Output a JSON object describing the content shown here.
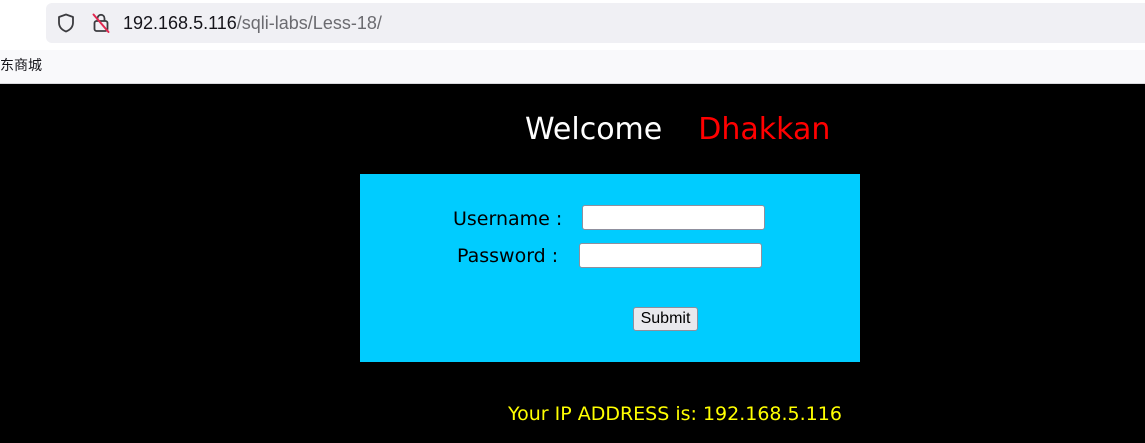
{
  "browser": {
    "url_host": "192.168.5.116",
    "url_path": "/sqli-labs/Less-18/",
    "bookmark": "东商城"
  },
  "page": {
    "welcome": "Welcome",
    "name": "Dhakkan",
    "form": {
      "username_label": "Username :",
      "password_label": "Password :",
      "username_value": "",
      "password_value": "",
      "submit_label": "Submit"
    },
    "ip_text": "Your IP ADDRESS is: 192.168.5.116"
  },
  "colors": {
    "page_background": "#000000",
    "form_background": "#00ccff",
    "welcome_text": "#ffffff",
    "name_text": "#ff0000",
    "ip_text": "#ffff00"
  },
  "icons": [
    "shield-icon",
    "insecure-lock-icon"
  ]
}
